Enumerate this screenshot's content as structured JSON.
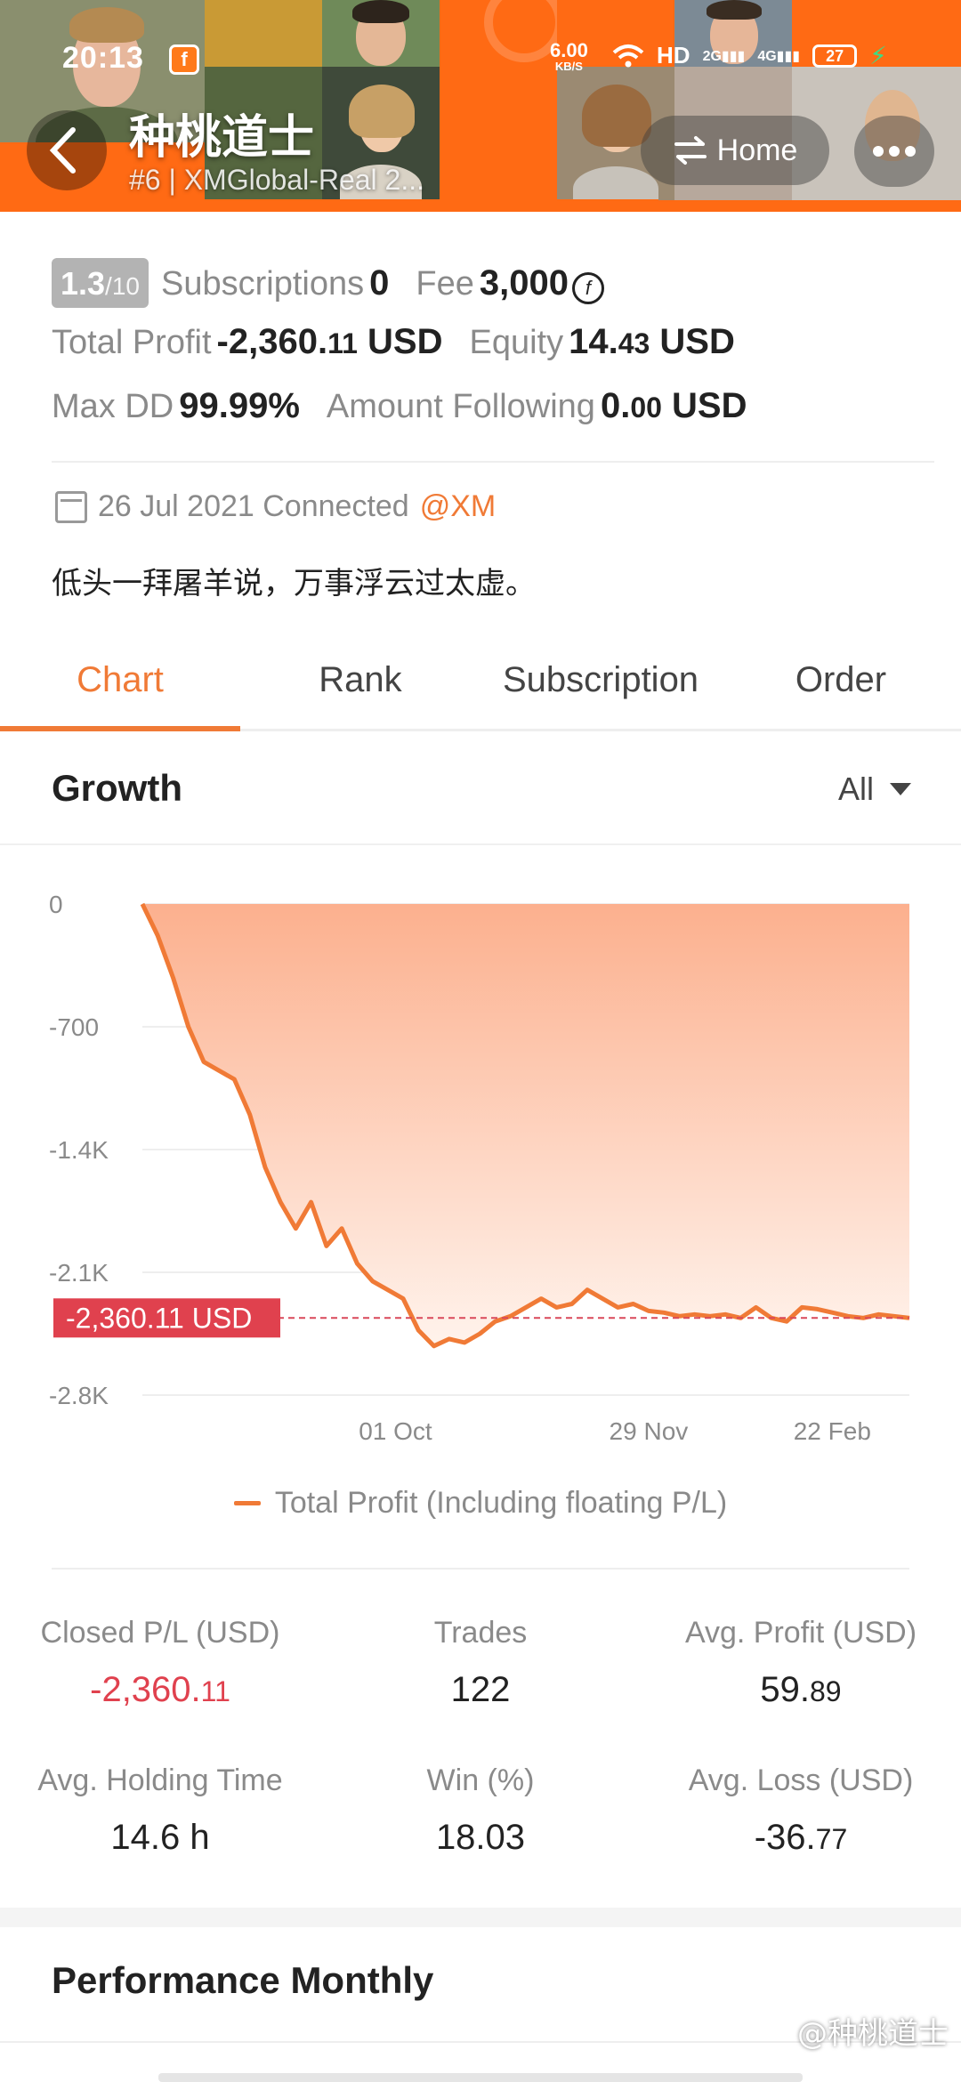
{
  "status_bar": {
    "time": "20:13",
    "network_speed_value": "6.00",
    "network_speed_unit": "KB/S",
    "icons": [
      "wifi-icon",
      "hd-icon",
      "2g-signal-icon",
      "4g-signal-icon"
    ],
    "hd_label": "HD",
    "sig1_label": "2G",
    "sig2_label": "4G",
    "battery": "27"
  },
  "header": {
    "back_icon": "chevron-left-icon",
    "trader_name": "种桃道士",
    "subtitle": "#6 | XMGlobal-Real 2...",
    "home_label": "Home",
    "more_icon": "more-dots-icon",
    "accent": "#ff6a14"
  },
  "info": {
    "rating_value": "1.3",
    "rating_scale": "/10",
    "subscriptions_label": "Subscriptions",
    "subscriptions_value": "0",
    "fee_label": "Fee",
    "fee_value": "3,000",
    "total_profit_label": "Total Profit",
    "total_profit_main": "-2,360.",
    "total_profit_decimals": "11",
    "total_profit_unit": "USD",
    "equity_label": "Equity",
    "equity_main": "14.",
    "equity_decimals": "43",
    "equity_unit": "USD",
    "max_dd_label": "Max DD",
    "max_dd_value": "99.99%",
    "amount_following_label": "Amount Following",
    "amount_following_main": "0.",
    "amount_following_decimals": "00",
    "amount_following_unit": "USD",
    "connected_text": "26 Jul 2021 Connected",
    "broker_tag": "@XM",
    "motto": "低头一拜屠羊说，万事浮云过太虚。"
  },
  "tabs": [
    {
      "label": "Chart",
      "active": true
    },
    {
      "label": "Rank",
      "active": false
    },
    {
      "label": "Subscription",
      "active": false
    },
    {
      "label": "Order",
      "active": false
    }
  ],
  "growth": {
    "title": "Growth",
    "period": "All"
  },
  "chart_data": {
    "type": "area",
    "series": [
      {
        "name": "Total Profit (Including floating P/L)",
        "color": "#f07a36",
        "x": [
          0,
          2,
          4,
          6,
          8,
          10,
          12,
          14,
          16,
          18,
          20,
          22,
          24,
          26,
          28,
          30,
          32,
          34,
          36,
          38,
          40,
          42,
          44,
          46,
          48,
          50,
          52,
          54,
          56,
          58,
          60,
          62,
          64,
          66,
          68,
          70,
          72,
          74,
          76,
          78,
          80,
          82,
          84,
          86,
          88,
          90,
          92,
          94,
          96,
          98,
          100
        ],
        "values": [
          0,
          -180,
          -420,
          -700,
          -900,
          -950,
          -1000,
          -1200,
          -1500,
          -1700,
          -1850,
          -1700,
          -1950,
          -1850,
          -2050,
          -2150,
          -2200,
          -2250,
          -2430,
          -2520,
          -2480,
          -2500,
          -2450,
          -2380,
          -2350,
          -2300,
          -2250,
          -2300,
          -2280,
          -2200,
          -2250,
          -2300,
          -2280,
          -2320,
          -2330,
          -2350,
          -2340,
          -2350,
          -2340,
          -2360,
          -2300,
          -2360,
          -2380,
          -2300,
          -2310,
          -2330,
          -2350,
          -2360,
          -2340,
          -2350,
          -2360.11
        ]
      }
    ],
    "y_ticks": [
      "0",
      "-700",
      "-1.4K",
      "-2.1K",
      "-2.8K"
    ],
    "y_tick_values": [
      0,
      -700,
      -1400,
      -2100,
      -2800
    ],
    "ylim": [
      -2800,
      0
    ],
    "x_ticks": [
      "01 Oct",
      "29 Nov",
      "22 Feb"
    ],
    "x_tick_positions": [
      33,
      66,
      95
    ],
    "current_label": "-2,360.11 USD",
    "current_value": -2360.11,
    "grid": true,
    "legend_position": "bottom"
  },
  "stats": [
    {
      "label": "Closed P/L (USD)",
      "main": "-2,360.",
      "decimals": "11",
      "negative": true
    },
    {
      "label": "Trades",
      "main": "122",
      "decimals": "",
      "negative": false
    },
    {
      "label": "Avg. Profit (USD)",
      "main": "59.",
      "decimals": "89",
      "negative": false
    },
    {
      "label": "Avg. Holding Time",
      "main": "14.6 h",
      "decimals": "",
      "negative": false
    },
    {
      "label": "Win (%)",
      "main": "18.03",
      "decimals": "",
      "negative": false
    },
    {
      "label": "Avg. Loss (USD)",
      "main": "-36.",
      "decimals": "77",
      "negative": false
    }
  ],
  "performance": {
    "title": "Performance Monthly"
  },
  "watermark": "@种桃道士"
}
